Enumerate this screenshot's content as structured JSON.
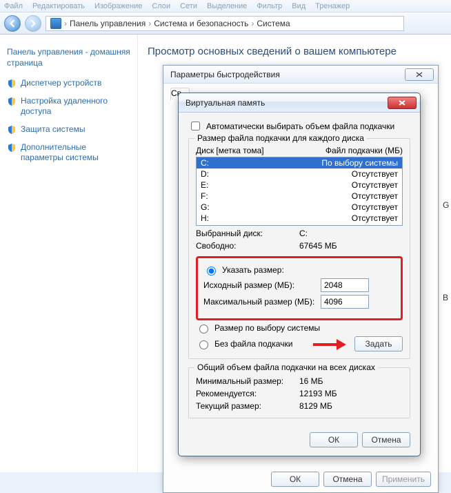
{
  "menu": [
    "Файл",
    "Редактировать",
    "Изображение",
    "Слои",
    "Сети",
    "Выделение",
    "Фильтр",
    "Вид",
    "Тренажер"
  ],
  "breadcrumb": {
    "icon": "control-panel-icon",
    "items": [
      "Панель управления",
      "Система и безопасность",
      "Система"
    ],
    "sep": "›"
  },
  "sidebar": {
    "home": "Панель управления - домашняя страница",
    "items": [
      "Диспетчер устройств",
      "Настройка удаленного доступа",
      "Защита системы",
      "Дополнительные параметры системы"
    ]
  },
  "main_title": "Просмотр основных сведений о вашем компьютере",
  "dlg_perf": {
    "title": "Параметры быстродействия",
    "tab": "Св",
    "ok": "ОК",
    "cancel": "Отмена",
    "apply": "Применить"
  },
  "dlg_vm": {
    "title": "Виртуальная память",
    "auto_chk": "Автоматически выбирать объем файла подкачки",
    "grp_legend": "Размер файла подкачки для каждого диска",
    "head_left": "Диск [метка тома]",
    "head_right": "Файл подкачки (МБ)",
    "disks": [
      {
        "d": "C:",
        "v": "По выбору системы",
        "sel": true
      },
      {
        "d": "D:",
        "v": "Отсутствует"
      },
      {
        "d": "E:",
        "v": "Отсутствует"
      },
      {
        "d": "F:",
        "v": "Отсутствует"
      },
      {
        "d": "G:",
        "v": "Отсутствует"
      },
      {
        "d": "H:",
        "v": "Отсутствует"
      }
    ],
    "sel_drive_k": "Выбранный диск:",
    "sel_drive_v": "C:",
    "free_k": "Свободно:",
    "free_v": "67645 МБ",
    "r_custom": "Указать размер:",
    "init_lbl": "Исходный размер (МБ):",
    "init_val": "2048",
    "max_lbl": "Максимальный размер (МБ):",
    "max_val": "4096",
    "r_system": "Размер по выбору системы",
    "r_none": "Без файла подкачки",
    "set_btn": "Задать",
    "tot_legend": "Общий объем файла подкачки на всех дисках",
    "min_k": "Минимальный размер:",
    "min_v": "16 МБ",
    "rec_k": "Рекомендуется:",
    "rec_v": "12193 МБ",
    "cur_k": "Текущий размер:",
    "cur_v": "8129 МБ",
    "ok": "ОК",
    "cancel": "Отмена"
  },
  "rightpeek": [
    "G",
    "В"
  ]
}
